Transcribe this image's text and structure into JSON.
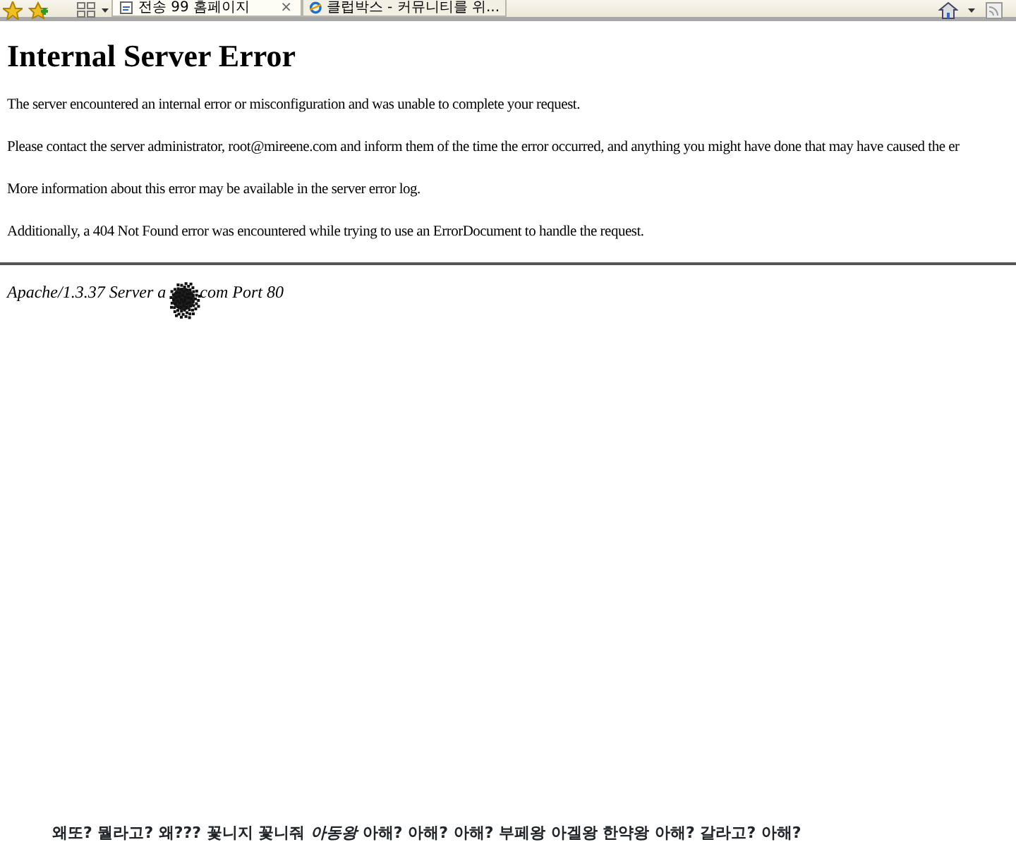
{
  "toolbar": {
    "tabs": [
      {
        "label": "전송 99 홈페이지",
        "selected": true,
        "close": "×"
      },
      {
        "label": "클럽박스 - 커뮤니티를 위...",
        "selected": false
      }
    ]
  },
  "page": {
    "title": "Internal Server Error",
    "paragraphs": [
      "The server encountered an internal error or misconfiguration and was unable to complete your request.",
      "Please contact the server administrator, root@mireene.com and inform them of the time the error occurred, and anything you might have done that may have caused the er",
      "More information about this error may be available in the server error log.",
      "Additionally, a 404 Not Found error was encountered while trying to use an ErrorDocument to handle the request."
    ],
    "footer": {
      "before": "Apache/1.3.37 Server a",
      "after": "com Port 80"
    }
  },
  "caption": "왜또? 뭘라고? 왜??? 꽃니지 꽃니줘 *아동왕* 아해? 아해? 아해? 부페왕 아겔왕 한약왕 아해? 갈라고? 아해?"
}
